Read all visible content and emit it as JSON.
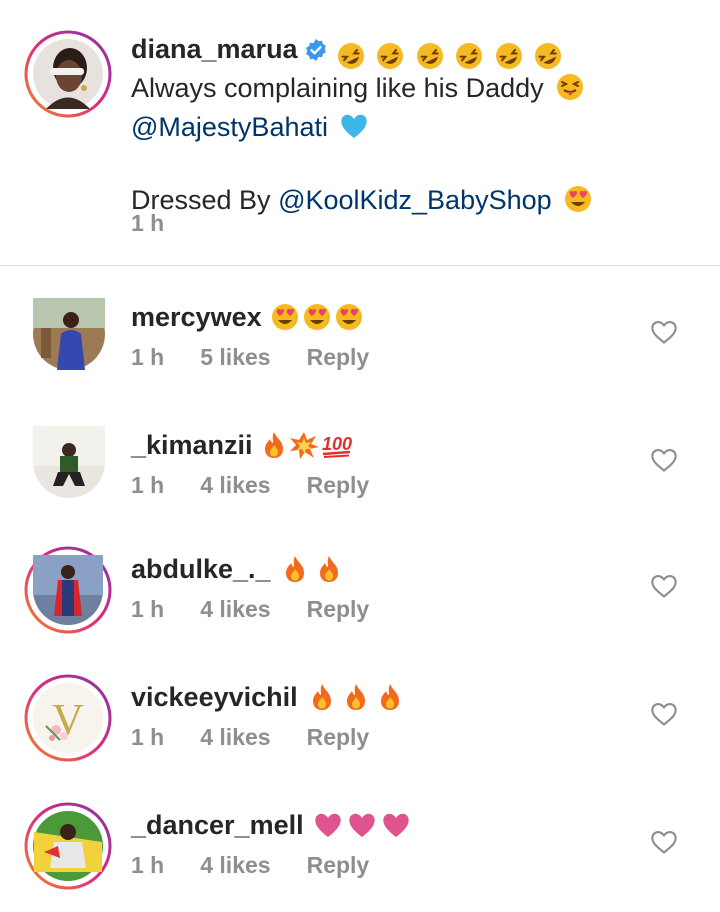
{
  "caption": {
    "username": "diana_marua",
    "line1": "Always complaining like his Daddy",
    "mention1": "@MajestyBahati",
    "line2_prefix": "Dressed By ",
    "mention2": "@KoolKidz_BabyShop",
    "time": "1 h",
    "icons": [
      "verified-badge-icon",
      "rolling-laughing-emoji",
      "squinting-tongue-emoji",
      "blue-heart-emoji",
      "heart-eyes-emoji"
    ]
  },
  "comments": [
    {
      "username": "mercywex",
      "emoji_type": "heart-eyes",
      "emoji_count": 3,
      "time": "1 h",
      "likes": "5 likes",
      "reply": "Reply",
      "avatar_ring": false
    },
    {
      "username": "_kimanzii",
      "emoji_type": "fire-collision-100",
      "emoji_count": 3,
      "time": "1 h",
      "likes": "4 likes",
      "reply": "Reply",
      "avatar_ring": false
    },
    {
      "username": "abdulke_._",
      "emoji_type": "fire",
      "emoji_count": 2,
      "time": "1 h",
      "likes": "4 likes",
      "reply": "Reply",
      "avatar_ring": true
    },
    {
      "username": "vickeeyvichil",
      "emoji_type": "fire",
      "emoji_count": 3,
      "time": "1 h",
      "likes": "4 likes",
      "reply": "Reply",
      "avatar_ring": true
    },
    {
      "username": "_dancer_mell",
      "emoji_type": "pink-heart",
      "emoji_count": 3,
      "time": "1 h",
      "likes": "4 likes",
      "reply": "Reply",
      "avatar_ring": true
    }
  ],
  "colors": {
    "mention": "#003569",
    "secondary_text": "#8e8e8e",
    "verified": "#3897f0",
    "divider": "#dbdbdb"
  }
}
